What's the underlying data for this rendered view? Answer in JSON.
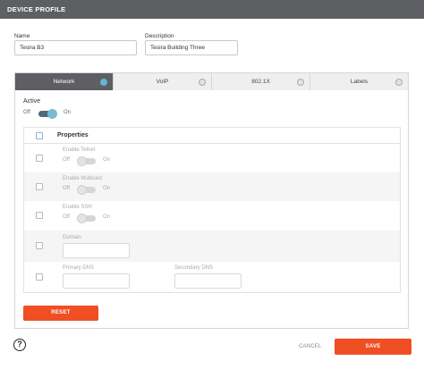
{
  "header": {
    "title": "DEVICE PROFILE"
  },
  "form": {
    "name_label": "Name",
    "name_value": "Tesira B3",
    "description_label": "Description",
    "description_value": "Tesira Building Three"
  },
  "tabs": [
    {
      "label": "Network",
      "active": true
    },
    {
      "label": "VoIP",
      "active": false
    },
    {
      "label": "802.1X",
      "active": false
    },
    {
      "label": "Labels",
      "active": false
    }
  ],
  "network": {
    "active_label": "Active",
    "off_label": "Off",
    "on_label": "On",
    "properties_label": "Properties",
    "telnet_label": "Enable Telnet",
    "multicast_label": "Enable Multicast",
    "ssh_label": "Enable SSH",
    "domain_label": "Domain",
    "primary_dns_label": "Primary DNS",
    "secondary_dns_label": "Secondary DNS",
    "reset_label": "RESET"
  },
  "footer": {
    "help_symbol": "?",
    "cancel_label": "CANCEL",
    "save_label": "SAVE"
  },
  "colors": {
    "accent": "#f04e23",
    "header": "#5d5f63",
    "toggle_on": "#78bbd4"
  }
}
